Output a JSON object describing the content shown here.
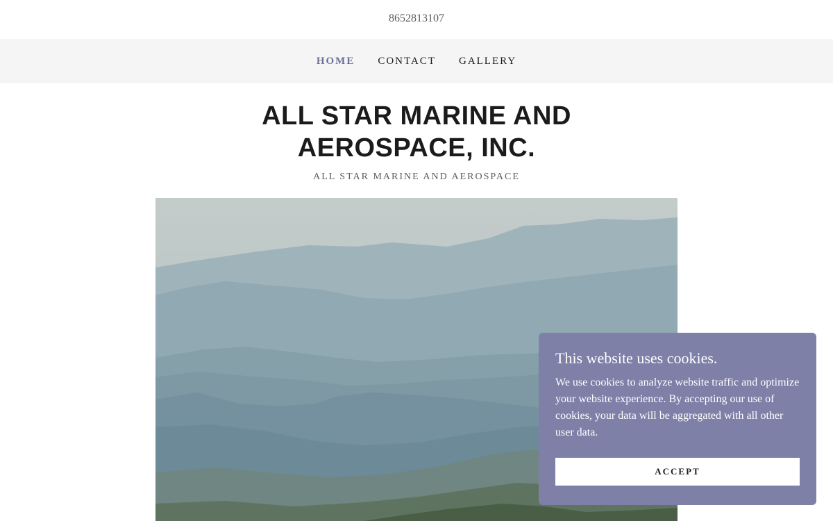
{
  "header": {
    "phone": "8652813107"
  },
  "nav": {
    "items": [
      {
        "label": "HOME",
        "active": true
      },
      {
        "label": "CONTACT",
        "active": false
      },
      {
        "label": "GALLERY",
        "active": false
      }
    ],
    "active_color": "#6c6f9a"
  },
  "hero": {
    "title": "ALL STAR MARINE AND AEROSPACE, INC.",
    "tagline": "ALL STAR MARINE AND AEROSPACE",
    "image_subject": "misty-mountain-ranges"
  },
  "cookie_banner": {
    "title": "This website uses cookies.",
    "body": "We use cookies to analyze website traffic and optimize your website experience. By accepting our use of cookies, your data will be aggregated with all other user data.",
    "accept_label": "ACCEPT",
    "background_color": "#7e80a8"
  }
}
